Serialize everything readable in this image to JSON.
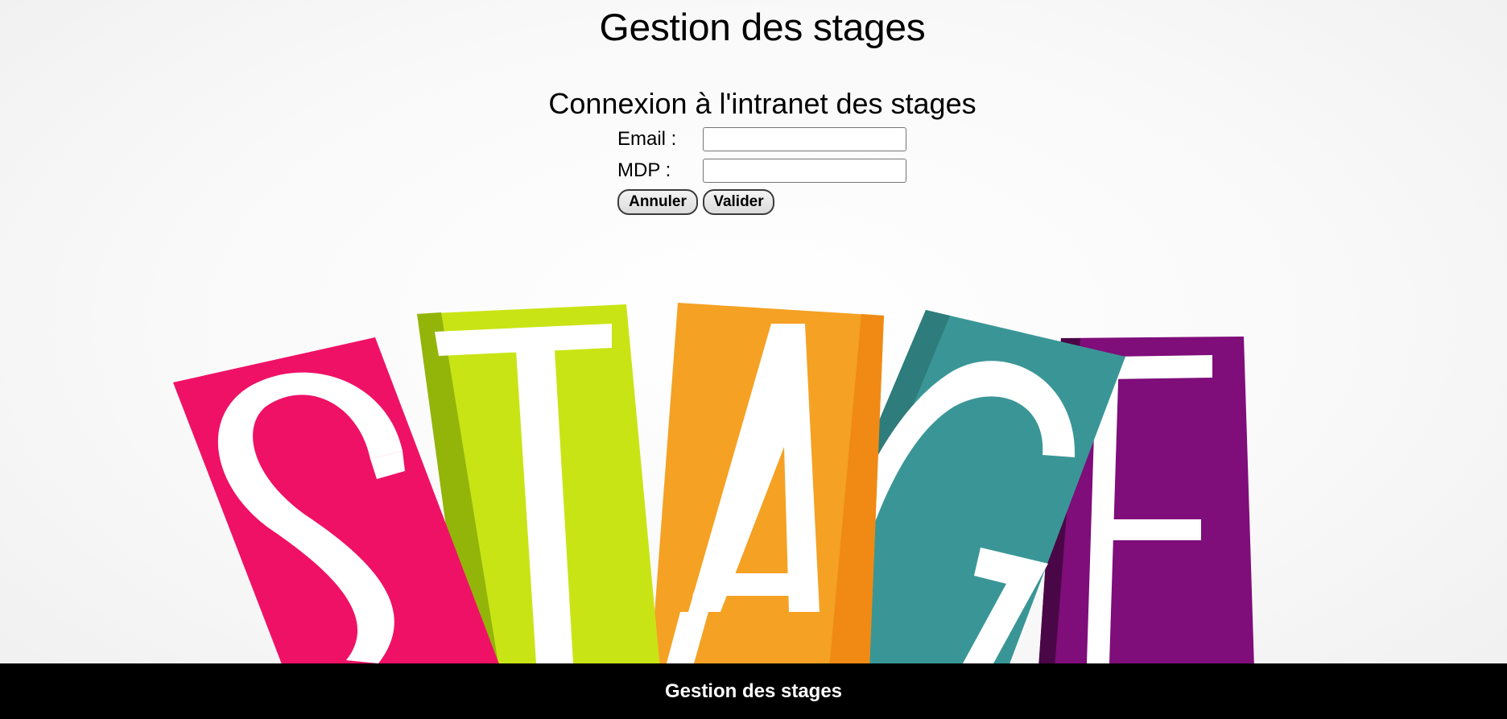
{
  "header": {
    "title": "Gestion des stages"
  },
  "login": {
    "heading": "Connexion à l'intranet des stages",
    "email_label": "Email :",
    "email_value": "",
    "password_label": "MDP :",
    "password_value": "",
    "cancel_label": "Annuler",
    "submit_label": "Valider"
  },
  "illustration": {
    "letters": [
      "S",
      "T",
      "A",
      "G",
      "E"
    ],
    "colors": [
      "#ef1166",
      "#c9e415",
      "#f5a123",
      "#3a9696",
      "#7f0d7a"
    ]
  },
  "footer": {
    "text": "Gestion des stages"
  }
}
